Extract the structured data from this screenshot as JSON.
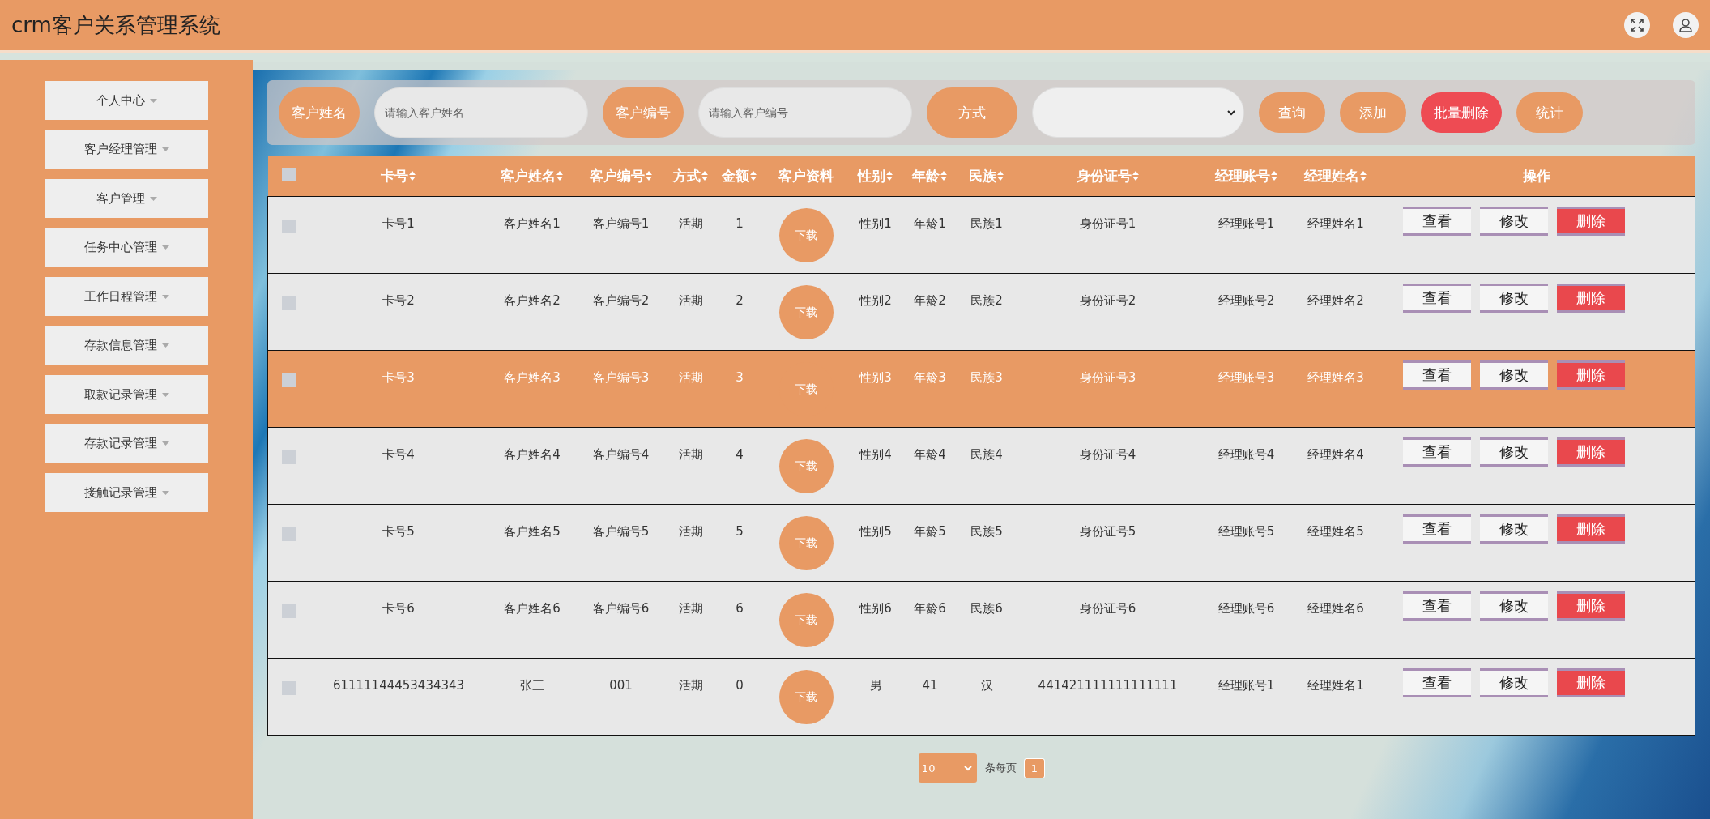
{
  "header": {
    "title": "crm客户关系管理系统"
  },
  "sidebar": {
    "items": [
      {
        "label": "个人中心"
      },
      {
        "label": "客户经理管理"
      },
      {
        "label": "客户管理"
      },
      {
        "label": "任务中心管理"
      },
      {
        "label": "工作日程管理"
      },
      {
        "label": "存款信息管理"
      },
      {
        "label": "取款记录管理"
      },
      {
        "label": "存款记录管理"
      },
      {
        "label": "接触记录管理"
      }
    ]
  },
  "search": {
    "fields": [
      {
        "label": "客户姓名",
        "placeholder": "请输入客户姓名"
      },
      {
        "label": "客户编号",
        "placeholder": "请输入客户编号"
      }
    ],
    "method_label": "方式",
    "buttons": [
      {
        "label": "查询",
        "kind": "normal"
      },
      {
        "label": "添加",
        "kind": "normal"
      },
      {
        "label": "批量删除",
        "kind": "danger"
      },
      {
        "label": "统计",
        "kind": "normal"
      }
    ]
  },
  "table": {
    "columns": [
      {
        "label": "卡号",
        "sortable": true
      },
      {
        "label": "客户姓名",
        "sortable": true
      },
      {
        "label": "客户编号",
        "sortable": true
      },
      {
        "label": "方式",
        "sortable": true
      },
      {
        "label": "金额",
        "sortable": true
      },
      {
        "label": "客户资料",
        "sortable": false
      },
      {
        "label": "性别",
        "sortable": true
      },
      {
        "label": "年龄",
        "sortable": true
      },
      {
        "label": "民族",
        "sortable": true
      },
      {
        "label": "身份证号",
        "sortable": true
      },
      {
        "label": "经理账号",
        "sortable": true
      },
      {
        "label": "经理姓名",
        "sortable": true
      },
      {
        "label": "操作",
        "sortable": false
      }
    ],
    "all_checked": false,
    "rows": [
      {
        "selected": false,
        "checked": false,
        "cells": [
          "卡号1",
          "客户姓名1",
          "客户编号1",
          "活期",
          "1",
          "下载",
          "性别1",
          "年龄1",
          "民族1",
          "身份证号1",
          "经理账号1",
          "经理姓名1"
        ],
        "actions": [
          {
            "label": "查看",
            "kind": "view"
          },
          {
            "label": "修改",
            "kind": "edit"
          },
          {
            "label": "删除",
            "kind": "delete"
          }
        ]
      },
      {
        "selected": false,
        "checked": false,
        "cells": [
          "卡号2",
          "客户姓名2",
          "客户编号2",
          "活期",
          "2",
          "下载",
          "性别2",
          "年龄2",
          "民族2",
          "身份证号2",
          "经理账号2",
          "经理姓名2"
        ],
        "actions": [
          {
            "label": "查看",
            "kind": "view"
          },
          {
            "label": "修改",
            "kind": "edit"
          },
          {
            "label": "删除",
            "kind": "delete"
          }
        ]
      },
      {
        "selected": true,
        "checked": false,
        "cells": [
          "卡号3",
          "客户姓名3",
          "客户编号3",
          "活期",
          "3",
          "下载",
          "性别3",
          "年龄3",
          "民族3",
          "身份证号3",
          "经理账号3",
          "经理姓名3"
        ],
        "actions": [
          {
            "label": "查看",
            "kind": "view"
          },
          {
            "label": "修改",
            "kind": "edit"
          },
          {
            "label": "删除",
            "kind": "delete"
          }
        ]
      },
      {
        "selected": false,
        "checked": false,
        "cells": [
          "卡号4",
          "客户姓名4",
          "客户编号4",
          "活期",
          "4",
          "下载",
          "性别4",
          "年龄4",
          "民族4",
          "身份证号4",
          "经理账号4",
          "经理姓名4"
        ],
        "actions": [
          {
            "label": "查看",
            "kind": "view"
          },
          {
            "label": "修改",
            "kind": "edit"
          },
          {
            "label": "删除",
            "kind": "delete"
          }
        ]
      },
      {
        "selected": false,
        "checked": false,
        "cells": [
          "卡号5",
          "客户姓名5",
          "客户编号5",
          "活期",
          "5",
          "下载",
          "性别5",
          "年龄5",
          "民族5",
          "身份证号5",
          "经理账号5",
          "经理姓名5"
        ],
        "actions": [
          {
            "label": "查看",
            "kind": "view"
          },
          {
            "label": "修改",
            "kind": "edit"
          },
          {
            "label": "删除",
            "kind": "delete"
          }
        ]
      },
      {
        "selected": false,
        "checked": false,
        "cells": [
          "卡号6",
          "客户姓名6",
          "客户编号6",
          "活期",
          "6",
          "下载",
          "性别6",
          "年龄6",
          "民族6",
          "身份证号6",
          "经理账号6",
          "经理姓名6"
        ],
        "actions": [
          {
            "label": "查看",
            "kind": "view"
          },
          {
            "label": "修改",
            "kind": "edit"
          },
          {
            "label": "删除",
            "kind": "delete"
          }
        ]
      },
      {
        "selected": false,
        "checked": false,
        "cells": [
          "61111144453434343",
          "张三",
          "001",
          "活期",
          "0",
          "下载",
          "男",
          "41",
          "汉",
          "441421111111111111",
          "经理账号1",
          "经理姓名1"
        ],
        "actions": [
          {
            "label": "查看",
            "kind": "view"
          },
          {
            "label": "修改",
            "kind": "edit"
          },
          {
            "label": "删除",
            "kind": "delete"
          }
        ]
      }
    ]
  },
  "pagination": {
    "page_size": "10",
    "per_page_label": "条每页",
    "pages": [
      {
        "label": "1",
        "selected": true
      }
    ]
  }
}
